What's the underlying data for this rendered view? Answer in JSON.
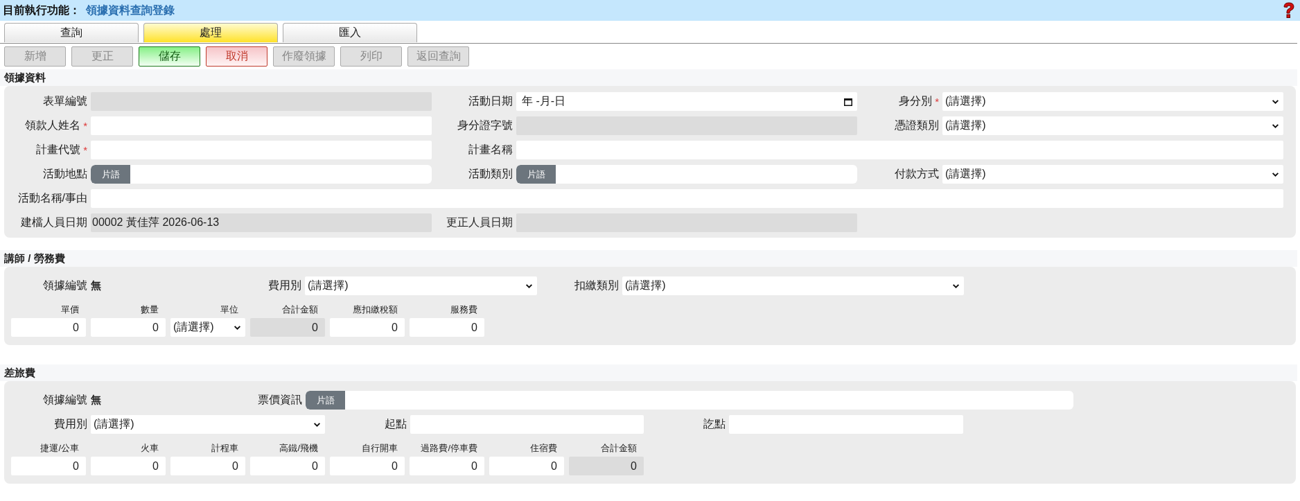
{
  "header": {
    "label": "目前執行功能：",
    "function": "領據資料查詢登錄"
  },
  "tabs": [
    {
      "label": "查詢",
      "selected": false
    },
    {
      "label": "處理",
      "selected": true
    },
    {
      "label": "匯入",
      "selected": false
    }
  ],
  "toolbar": [
    {
      "label": "新增",
      "kind": "plain",
      "disabled": true
    },
    {
      "label": "更正",
      "kind": "plain",
      "disabled": true
    },
    {
      "label": "儲存",
      "kind": "save",
      "disabled": false
    },
    {
      "label": "取消",
      "kind": "cancel",
      "disabled": false
    },
    {
      "label": "作廢領據",
      "kind": "plain",
      "disabled": true
    },
    {
      "label": "列印",
      "kind": "plain",
      "disabled": true
    },
    {
      "label": "返回查詢",
      "kind": "plain",
      "disabled": true
    }
  ],
  "receipt": {
    "title": "領據資料",
    "fields": [
      {
        "label": "表單編號",
        "kind": "readonly"
      },
      {
        "label": "活動日期",
        "kind": "date",
        "value": "年 -月-日"
      },
      {
        "label": "身分別",
        "required_mark": "*",
        "kind": "select",
        "value": "(請選擇)"
      },
      {
        "label": "領款人姓名",
        "required_mark": "*",
        "kind": "text"
      },
      {
        "label": "身分證字號",
        "kind": "readonly"
      },
      {
        "label": "憑證類別",
        "kind": "select",
        "value": "(請選擇)"
      },
      {
        "label": "計畫代號",
        "required_mark": "*",
        "kind": "text"
      },
      {
        "label": "計畫名稱",
        "kind": "text",
        "wide": true
      },
      {
        "label": "活動地點",
        "kind": "phrase",
        "button": "片語"
      },
      {
        "label": "活動類別",
        "kind": "phrase",
        "button": "片語"
      },
      {
        "label": "付款方式",
        "kind": "select",
        "value": "(請選擇)"
      },
      {
        "label": "活動名稱/事由",
        "kind": "text",
        "wide": true
      },
      {
        "label": "建檔人員日期",
        "kind": "readonly",
        "value": "00002 黃佳萍 2026-06-13"
      },
      {
        "label": "更正人員日期",
        "kind": "readonly"
      }
    ]
  },
  "lecturer_fee": {
    "title": "講師 / 勞務費",
    "receipt_no": {
      "label": "領據編號",
      "value": "無"
    },
    "fields": [
      {
        "label": "費用別",
        "kind": "select",
        "value": "(請選擇)"
      },
      {
        "label": "扣繳類別",
        "kind": "select",
        "value": "(請選擇)"
      }
    ],
    "amounts": [
      {
        "label": "單價",
        "kind": "number",
        "value": "0"
      },
      {
        "label": "數量",
        "kind": "number",
        "value": "0"
      },
      {
        "label": "單位",
        "kind": "select",
        "value": "(請選擇)"
      },
      {
        "label": "合計金額",
        "kind": "readonly",
        "value": "0"
      },
      {
        "label": "應扣繳稅額",
        "kind": "number",
        "value": "0"
      },
      {
        "label": "服務費",
        "kind": "number",
        "value": "0"
      }
    ]
  },
  "travel_fee": {
    "title": "差旅費",
    "receipt_no": {
      "label": "領據編號",
      "value": "無"
    },
    "fields": [
      {
        "label": "票價資訊",
        "kind": "phrase",
        "button": "片語"
      },
      {
        "label": "費用別",
        "kind": "select",
        "value": "(請選擇)"
      },
      {
        "label": "起點",
        "kind": "text"
      },
      {
        "label": "訖點",
        "kind": "text"
      }
    ],
    "amounts": [
      {
        "label": "捷運/公車",
        "kind": "number",
        "value": "0"
      },
      {
        "label": "火車",
        "kind": "number",
        "value": "0"
      },
      {
        "label": "計程車",
        "kind": "number",
        "value": "0"
      },
      {
        "label": "高鐵/飛機",
        "kind": "number",
        "value": "0"
      },
      {
        "label": "自行開車",
        "kind": "number",
        "value": "0"
      },
      {
        "label": "過路費/停車費",
        "kind": "number",
        "value": "0"
      },
      {
        "label": "住宿費",
        "kind": "number",
        "value": "0"
      },
      {
        "label": "合計金額",
        "kind": "readonly",
        "value": "0"
      }
    ]
  }
}
